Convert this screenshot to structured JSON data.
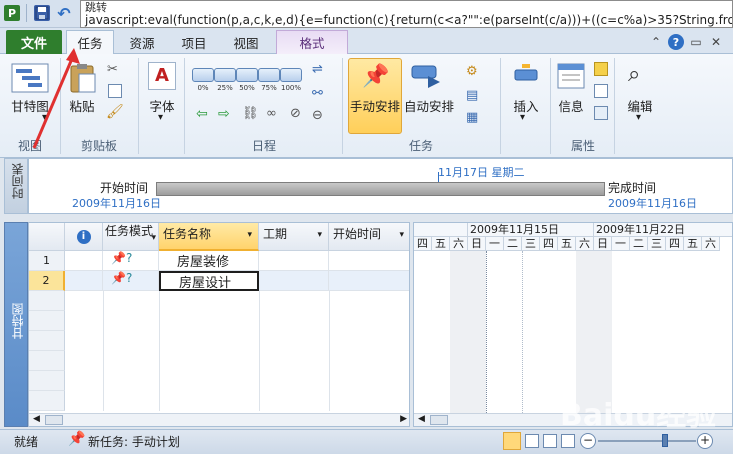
{
  "title_bar": {
    "app_icon": "project-logo-icon",
    "app_icon_letter": "P",
    "tooltip_title": "跳转",
    "tooltip_text": "javascript:eval(function(p,a,c,k,e,d){e=function(c){return(c<a?\"\":e(parseInt(c/a)))+((c=c%a)>35?String.fromCharCo"
  },
  "tabs": {
    "file": "文件",
    "task": "任务",
    "resource": "资源",
    "project": "项目",
    "view": "视图",
    "format": "格式"
  },
  "ribbon": {
    "view_group": {
      "gantt_button": "甘特图",
      "label": "视图"
    },
    "clipboard_group": {
      "paste_button": "粘贴",
      "label": "剪贴板"
    },
    "font_group": {
      "font_button": "字体"
    },
    "schedule_group": {
      "label": "日程",
      "percent_labels": [
        "0%",
        "25%",
        "50%",
        "75%",
        "100%"
      ]
    },
    "tasks_group": {
      "manual_button": "手动安排",
      "auto_button": "自动安排",
      "label": "任务"
    },
    "insert_group": {
      "insert_button": "插入"
    },
    "properties_group": {
      "info_button": "信息",
      "label": "属性"
    },
    "edit_group": {
      "edit_button": "编辑"
    }
  },
  "timeline": {
    "side_label": "时间表",
    "start_label": "开始时间",
    "start_date": "2009年11月16日",
    "finish_label": "完成时间",
    "finish_date": "2009年11月16日",
    "today_marker": "11月17日 星期二"
  },
  "grid": {
    "side_label": "甘特图",
    "columns": [
      "任务模式",
      "任务名称",
      "工期",
      "开始时间"
    ],
    "rows": [
      {
        "num": "1",
        "name": "房屋装修"
      },
      {
        "num": "2",
        "name": "房屋设计"
      }
    ]
  },
  "gantt": {
    "weeks": [
      "2009年11月15日",
      "2009年11月22日"
    ],
    "day_labels": [
      "四",
      "五",
      "六",
      "日",
      "一",
      "二",
      "三",
      "四",
      "五",
      "六",
      "日",
      "一",
      "二",
      "三",
      "四",
      "五",
      "六"
    ]
  },
  "status_bar": {
    "ready": "就绪",
    "new_task_mode": "新任务: 手动计划"
  },
  "watermark": "Baidu经验",
  "colors": {
    "file_tab": "#2f7e2d",
    "accent_blue": "#2f6fc4",
    "selected_button": "#ffcf5a",
    "timeline_bar": "#9d9d9d"
  }
}
